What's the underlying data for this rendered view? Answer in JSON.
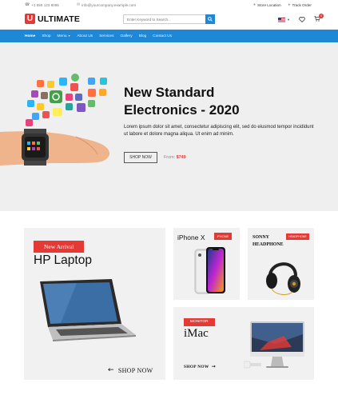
{
  "topbar": {
    "phone": "+1 555 123 8065",
    "email": "info@yourcompany.example.com",
    "store_location": "Store Location",
    "track_order": "Track Order"
  },
  "header": {
    "logo_letter": "U",
    "logo_text": "ULTIMATE",
    "search_placeholder": "Enter Keyword to Search...",
    "cart_count": "0"
  },
  "nav": {
    "items": [
      "Home",
      "Shop",
      "Menu",
      "About Us",
      "Services",
      "Gallery",
      "Blog",
      "Contact Us"
    ]
  },
  "hero": {
    "title_line1": "New Standard",
    "title_line2": "Electronics - 2020",
    "description": "Lorem ipsum dolor sit amet, consectetur adipiscing elit, sed do eiusmod tempor incididunt ut labore et dolore magna aliqua. Ut enim ad minim.",
    "button": "SHOP NOW",
    "price_prefix": "From:",
    "price": "$749"
  },
  "products": {
    "laptop": {
      "tag": "New Arrival",
      "title": "HP Laptop",
      "link": "SHOP NOW"
    },
    "iphone": {
      "title": "iPhone X",
      "tag": "PHONE"
    },
    "headphone": {
      "title_line1": "SONNY",
      "title_line2": "HEADPHONE",
      "tag": "HEADPHONE"
    },
    "imac": {
      "tag": "MONITOR",
      "title": "iMac",
      "link": "SHOP NOW"
    }
  },
  "colors": {
    "brand_blue": "#1e88d6",
    "accent_red": "#e53935"
  }
}
